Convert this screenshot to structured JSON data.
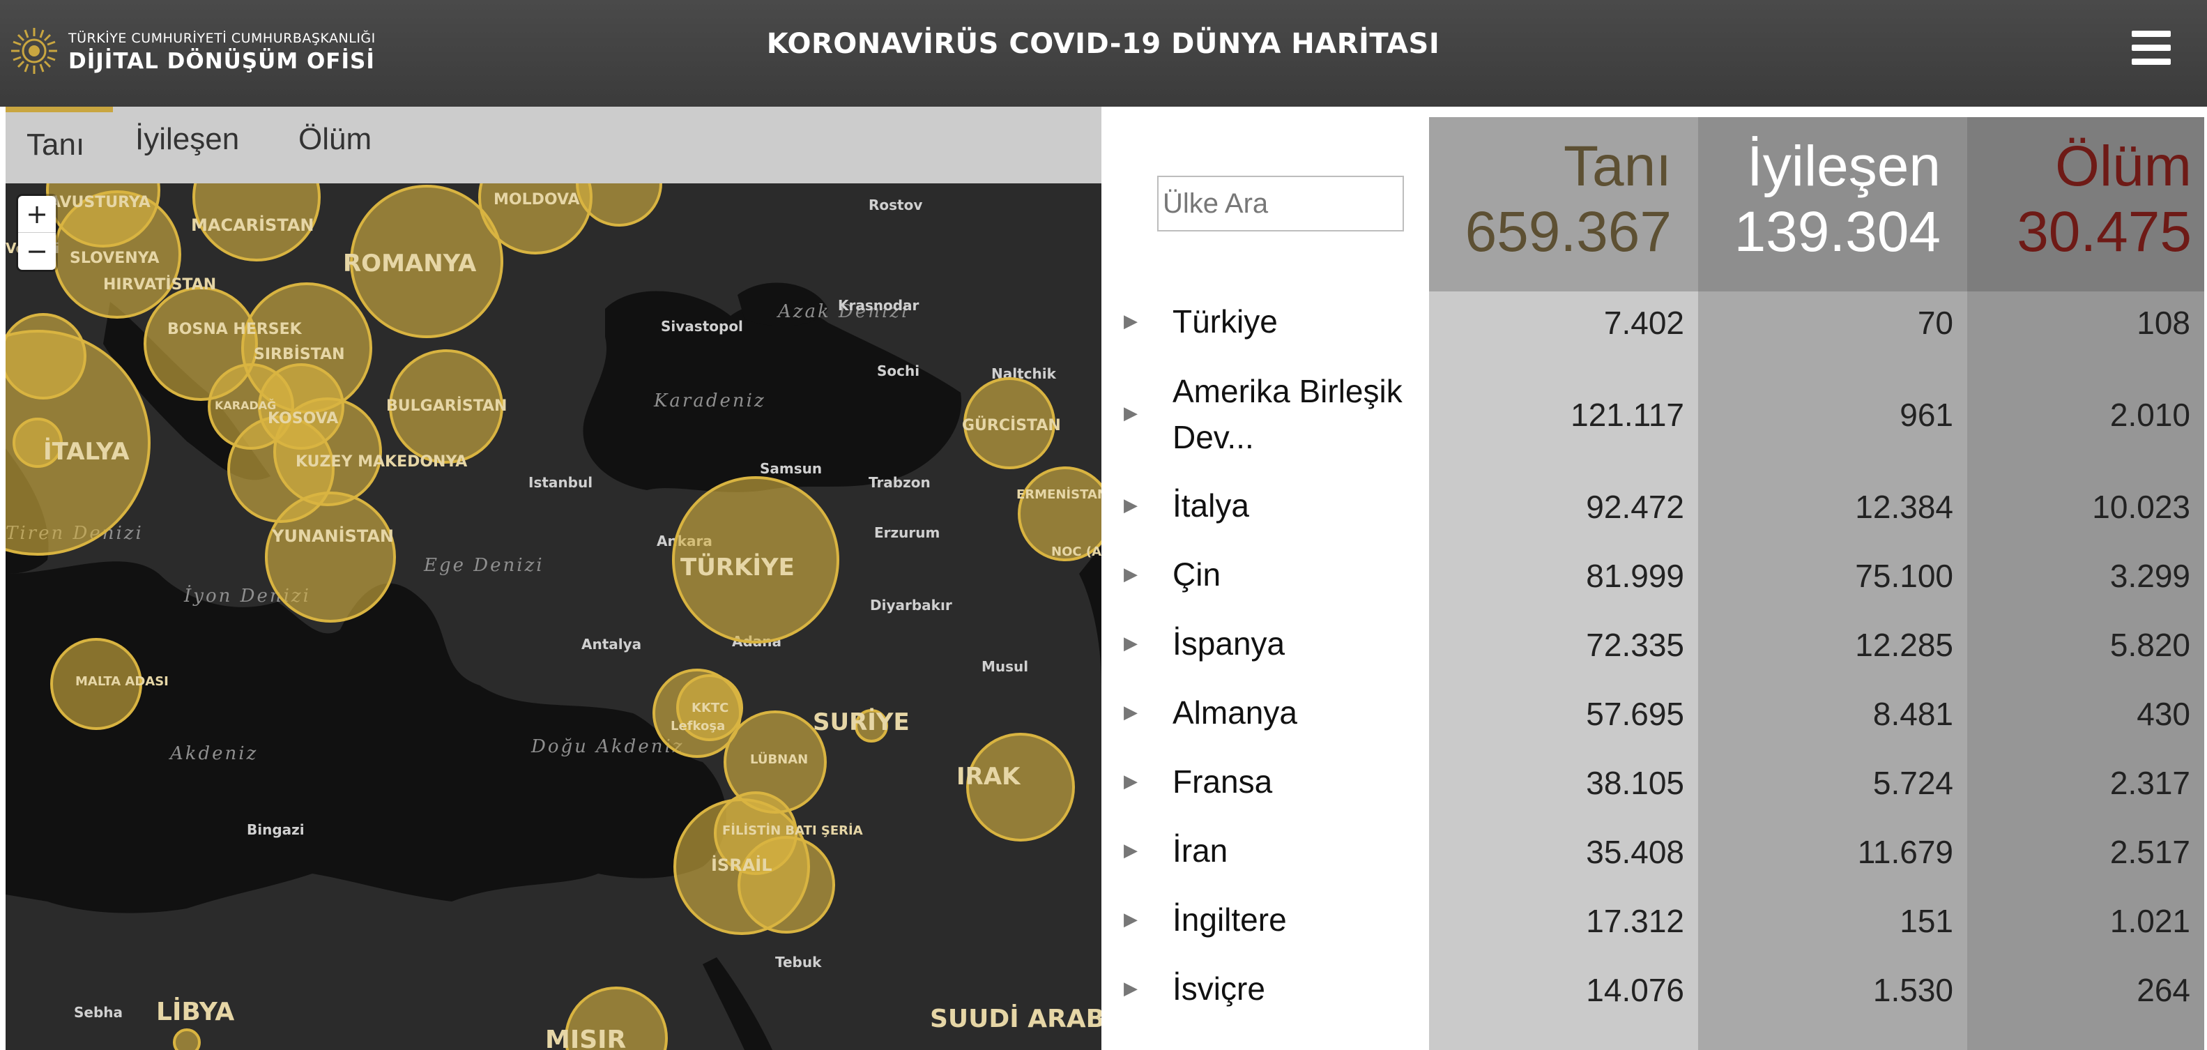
{
  "header": {
    "brand_top": "TÜRKİYE CUMHURİYETİ CUMHURBAŞKANLIĞI",
    "brand_main": "DİJİTAL DÖNÜŞÜM OFİSİ",
    "title": "KORONAVİRÜS COVID-19 DÜNYA HARİTASI",
    "logo_icon": "sun-emblem-icon",
    "menu_icon": "hamburger-menu-icon"
  },
  "map": {
    "tabs": [
      "Tanı",
      "İyileşen",
      "Ölüm"
    ],
    "active_tab": "Tanı",
    "zoom_in": "+",
    "zoom_out": "−",
    "sea_labels": [
      "Azak Denizi",
      "Karadeniz",
      "Ege Denizi",
      "İyon Denizi",
      "Tiren Denizi",
      "Akdeniz",
      "Doğu Akdeniz"
    ],
    "city_labels": [
      "Rostov",
      "Krasnodar",
      "Sivastopol",
      "Sochi",
      "Naltchik",
      "Samsun",
      "Trabzon",
      "Istanbul",
      "Ankara",
      "Erzurum",
      "Diyarbakır",
      "Antalya",
      "Adana",
      "Musul",
      "Bingazi",
      "Tebuk",
      "Sebha"
    ],
    "country_labels": [
      "AVUSTURYA",
      "MACARİSTAN",
      "MOLDOVA",
      "ROMANYA",
      "SLOVENYA",
      "HIRVATİSTAN",
      "BOSNA HERSEK",
      "SIRBİSTAN",
      "BULGARİSTAN",
      "KARADAĞ",
      "KOSOVA",
      "KUZEY MAKEDONYA",
      "İTALYA",
      "YUNANİSTAN",
      "GÜRCİSTAN",
      "ERMENİSTAN",
      "NOC (A",
      "TÜRKİYE",
      "MALTA ADASI",
      "KKTC",
      "Lefkoşa",
      "SURİYE",
      "LÜBNAN",
      "IRAK",
      "FİLİSTİN BATI ŞERİA",
      "İSRAİL",
      "LİBYA",
      "MISIR",
      "SUUDİ ARABİSTAN",
      "Venedi"
    ],
    "bubble_color": "#d9b441",
    "sea_color": "#111111",
    "land_color": "#2b2b2b"
  },
  "search": {
    "placeholder": "Ülke Ara"
  },
  "totals": {
    "tani_label": "Tanı",
    "tani_value": "659.367",
    "iyilesen_label": "İyileşen",
    "iyilesen_value": "139.304",
    "olum_label": "Ölüm",
    "olum_value": "30.475"
  },
  "rows": [
    {
      "country": "Türkiye",
      "tani": "7.402",
      "iyilesen": "70",
      "olum": "108"
    },
    {
      "country": "Amerika Birleşik Dev...",
      "tani": "121.117",
      "iyilesen": "961",
      "olum": "2.010"
    },
    {
      "country": "İtalya",
      "tani": "92.472",
      "iyilesen": "12.384",
      "olum": "10.023"
    },
    {
      "country": "Çin",
      "tani": "81.999",
      "iyilesen": "75.100",
      "olum": "3.299"
    },
    {
      "country": "İspanya",
      "tani": "72.335",
      "iyilesen": "12.285",
      "olum": "5.820"
    },
    {
      "country": "Almanya",
      "tani": "57.695",
      "iyilesen": "8.481",
      "olum": "430"
    },
    {
      "country": "Fransa",
      "tani": "38.105",
      "iyilesen": "5.724",
      "olum": "2.317"
    },
    {
      "country": "İran",
      "tani": "35.408",
      "iyilesen": "11.679",
      "olum": "2.517"
    },
    {
      "country": "İngiltere",
      "tani": "17.312",
      "iyilesen": "151",
      "olum": "1.021"
    },
    {
      "country": "İsviçre",
      "tani": "14.076",
      "iyilesen": "1.530",
      "olum": "264"
    }
  ],
  "row_arrow": "▶",
  "colors": {
    "header_bg": "#434343",
    "tani_header_text": "#5d5033",
    "iyilesen_header_text": "#ffffff",
    "olum_header_text": "#6e1a16",
    "tab_accent": "#c9a640"
  }
}
